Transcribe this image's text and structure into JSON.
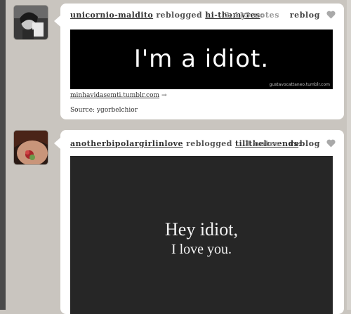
{
  "posts": [
    {
      "user": "unicornio-maldito",
      "verb": "reblogged",
      "from": "hi-thamyres",
      "colon": ":",
      "notes": "2,413 notes",
      "reblog": "reblog",
      "image_text": "I'm a idiot.",
      "watermark": "gustavocattaneo.tumblr.com",
      "link": "minhavidasemti.tumblr.com",
      "arrow": "→",
      "source_label": "Source:",
      "source_value": "ygorbelchior"
    },
    {
      "user": "anotherbipolargirlinlove",
      "verb": "reblogged",
      "from": "tillthelovends",
      "colon": ":",
      "notes": "3 notes",
      "reblog": "reblog",
      "image_line1": "Hey idiot,",
      "image_line2": "I love you."
    }
  ],
  "icons": {
    "heart": "heart-icon",
    "avatar1": "avatar-photo-person",
    "avatar2": "avatar-photo-back-tattoo"
  },
  "colors": {
    "background": "#c9c5bf",
    "card": "#ffffff",
    "heart": "#a9a9a9",
    "notes": "#9a9a9a"
  }
}
